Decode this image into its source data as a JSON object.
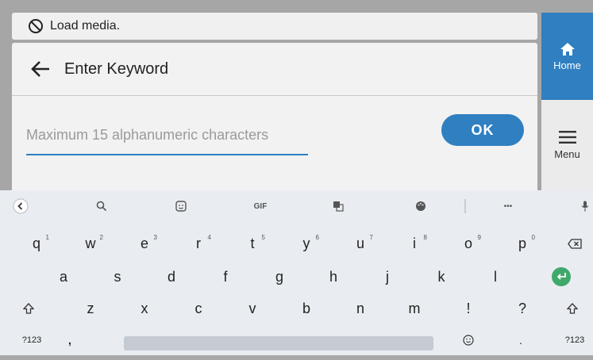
{
  "status": {
    "text": "Load media."
  },
  "header": {
    "title": "Enter Keyword"
  },
  "search": {
    "placeholder": "Maximum 15 alphanumeric characters",
    "value": ""
  },
  "ok_label": "OK",
  "side": {
    "home_label": "Home",
    "menu_label": "Menu"
  },
  "colors": {
    "accent": "#2f7fc1",
    "enter": "#3fa86b"
  },
  "keyboard": {
    "toolbar": {
      "gif": "GIF",
      "more": "•••"
    },
    "row1": [
      {
        "k": "q",
        "n": "1"
      },
      {
        "k": "w",
        "n": "2"
      },
      {
        "k": "e",
        "n": "3"
      },
      {
        "k": "r",
        "n": "4"
      },
      {
        "k": "t",
        "n": "5"
      },
      {
        "k": "y",
        "n": "6"
      },
      {
        "k": "u",
        "n": "7"
      },
      {
        "k": "i",
        "n": "8"
      },
      {
        "k": "o",
        "n": "9"
      },
      {
        "k": "p",
        "n": "0"
      }
    ],
    "row2": [
      "a",
      "s",
      "d",
      "f",
      "g",
      "h",
      "j",
      "k",
      "l"
    ],
    "row3": [
      "z",
      "x",
      "c",
      "v",
      "b",
      "n",
      "m",
      "!",
      "?"
    ],
    "row4": {
      "sym_left": "?123",
      "comma": ",",
      "period": ".",
      "sym_right": "?123"
    }
  }
}
